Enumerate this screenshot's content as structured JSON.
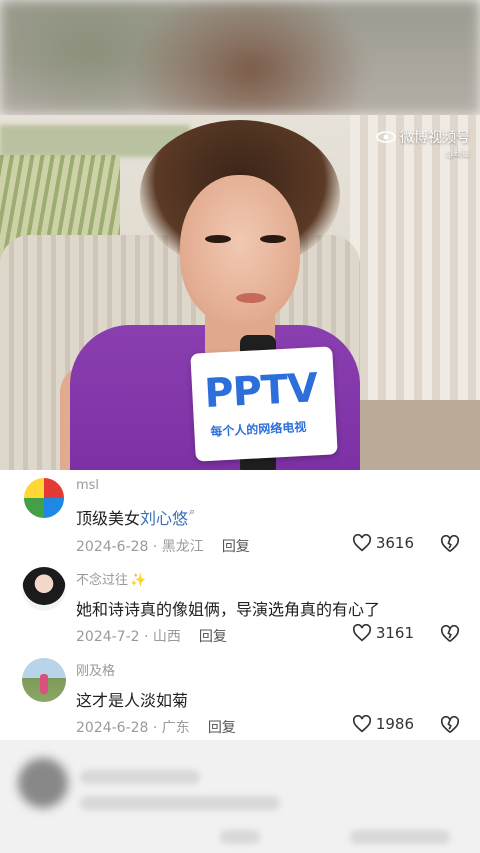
{
  "watermark": {
    "brand": "微博视频号",
    "handle": "@畸墨"
  },
  "video_overlay": {
    "logo_text": "PPTV",
    "slogan": "每个人的网络电视"
  },
  "comments": [
    {
      "username": "msl",
      "text_prefix": "顶级美女",
      "text_link": "刘心悠",
      "date_location": "2024-6-28 · 黑龙江",
      "reply_label": "回复",
      "likes": "3616"
    },
    {
      "username": "不念过往",
      "username_emoji": "✨",
      "text": "她和诗诗真的像姐俩，导演选角真的有心了",
      "date_location": "2024-7-2 · 山西",
      "reply_label": "回复",
      "likes": "3161"
    },
    {
      "username": "刚及格",
      "text": "这才是人淡如菊",
      "date_location": "2024-6-28 · 广东",
      "reply_label": "回复",
      "likes": "1986"
    }
  ],
  "colors": {
    "link": "#3b6fb6",
    "meta": "#9a9a9a",
    "pptv_blue": "#2c6fdb"
  }
}
